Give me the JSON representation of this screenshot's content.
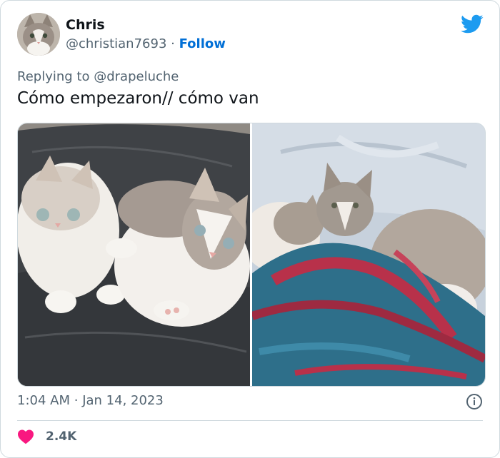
{
  "author": {
    "name": "Chris",
    "handle": "@christian7693",
    "separator": "·",
    "follow_label": "Follow"
  },
  "reply": {
    "prefix": "Replying to",
    "mention": "@drapeluche"
  },
  "tweet": {
    "text": "Cómo empezaron// cómo van"
  },
  "meta": {
    "time": "1:04 AM",
    "separator": "·",
    "date": "Jan 14, 2023"
  },
  "engagement": {
    "likes": "2.4K"
  },
  "colors": {
    "twitter_blue": "#1d9bf0",
    "like_pink": "#f91880",
    "link_blue": "#006fd6"
  },
  "icons": {
    "brand": "twitter-bird-icon",
    "info": "info-icon",
    "like": "heart-icon"
  }
}
